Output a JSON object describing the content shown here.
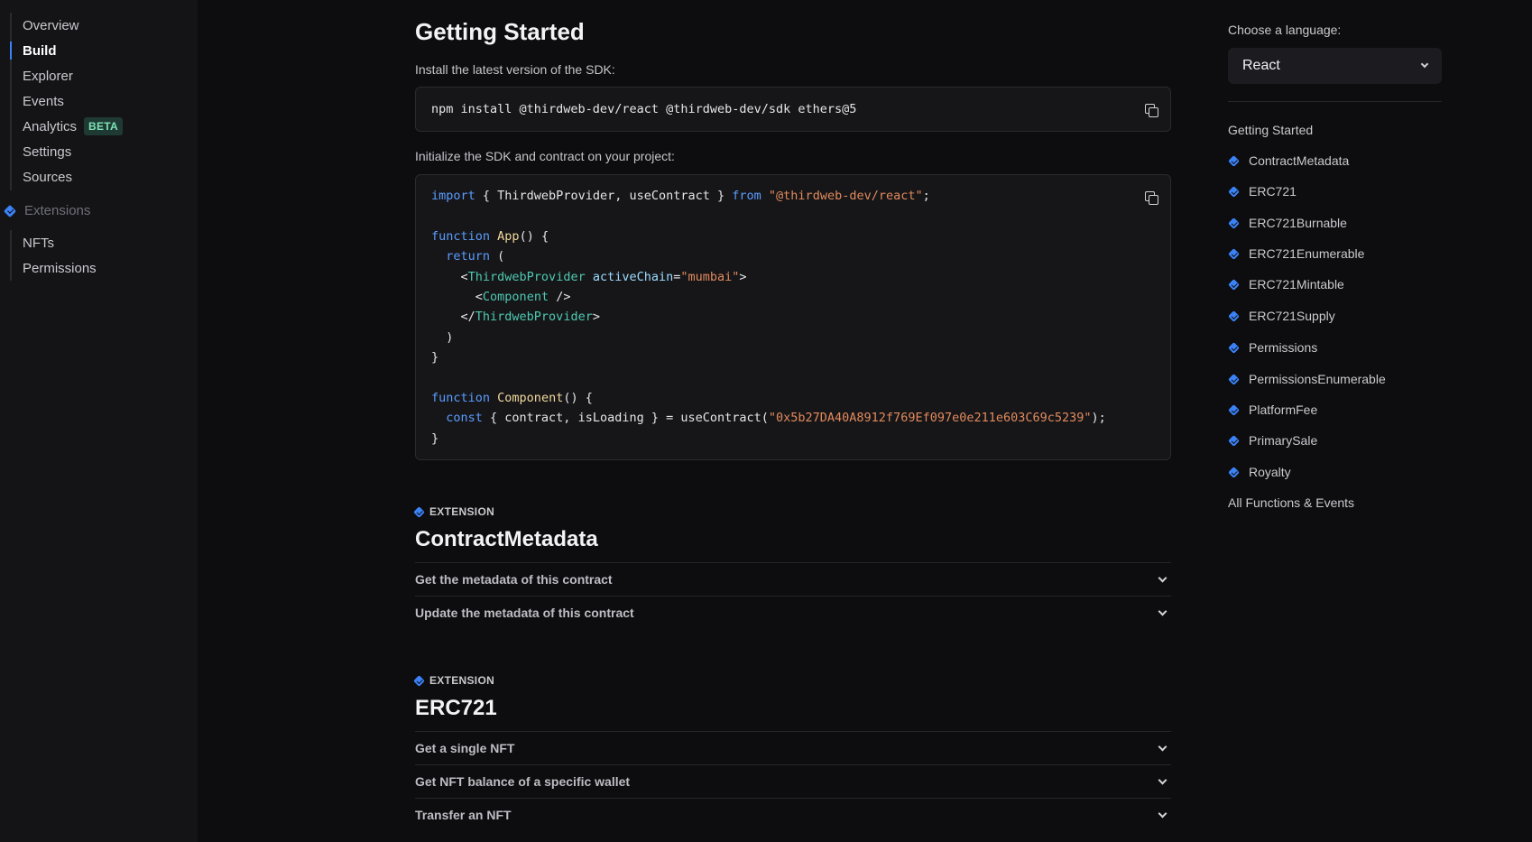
{
  "sidebar": {
    "items": [
      {
        "label": "Overview"
      },
      {
        "label": "Build"
      },
      {
        "label": "Explorer"
      },
      {
        "label": "Events"
      },
      {
        "label": "Analytics",
        "badge": "BETA"
      },
      {
        "label": "Settings"
      },
      {
        "label": "Sources"
      }
    ],
    "extensions_heading": "Extensions",
    "extension_items": [
      {
        "label": "NFTs"
      },
      {
        "label": "Permissions"
      }
    ]
  },
  "main": {
    "title": "Getting Started",
    "install_text": "Install the latest version of the SDK:",
    "install_command": "npm install @thirdweb-dev/react @thirdweb-dev/sdk ethers@5",
    "init_text": "Initialize the SDK and contract on your project:",
    "code": {
      "l1_import": "import",
      "l1_names": " { ThirdwebProvider, useContract } ",
      "l1_from": "from",
      "l1_module": "\"@thirdweb-dev/react\"",
      "l1_end": ";",
      "l3_function": "function",
      "l3_name": "App",
      "l3_rest": "() {",
      "l4_return": "return",
      "l4_rest": " (",
      "l5_open": "<",
      "l5_tag": "ThirdwebProvider",
      "l5_attr": "activeChain",
      "l5_eq": "=",
      "l5_val": "\"mumbai\"",
      "l5_close": ">",
      "l6_open": "<",
      "l6_tag": "Component",
      "l6_close": " />",
      "l7_open": "</",
      "l7_tag": "ThirdwebProvider",
      "l7_close": ">",
      "l8_paren": ")",
      "l9_brace": "}",
      "l11_function": "function",
      "l11_name": "Component",
      "l11_rest": "() {",
      "l12_const": "const",
      "l12_mid": " { contract, isLoading } = useContract(",
      "l12_addr": "\"0x5b27DA40A8912f769Ef097e0e211e603C69c5239\"",
      "l12_end": ");",
      "l13_brace": "}"
    },
    "extension_label": "EXTENSION",
    "sections": [
      {
        "title": "ContractMetadata",
        "rows": [
          "Get the metadata of this contract",
          "Update the metadata of this contract"
        ]
      },
      {
        "title": "ERC721",
        "rows": [
          "Get a single NFT",
          "Get NFT balance of a specific wallet",
          "Transfer an NFT"
        ]
      }
    ]
  },
  "right": {
    "language_label": "Choose a language:",
    "language_value": "React",
    "toc_first": "Getting Started",
    "toc_items": [
      "ContractMetadata",
      "ERC721",
      "ERC721Burnable",
      "ERC721Enumerable",
      "ERC721Mintable",
      "ERC721Supply",
      "Permissions",
      "PermissionsEnumerable",
      "PlatformFee",
      "PrimarySale",
      "Royalty"
    ],
    "toc_last": "All Functions & Events"
  },
  "colors": {
    "accent": "#3b82f6",
    "background": "#0d0d0f",
    "sidebar": "#141417",
    "beta_badge": "#1f3a33"
  }
}
